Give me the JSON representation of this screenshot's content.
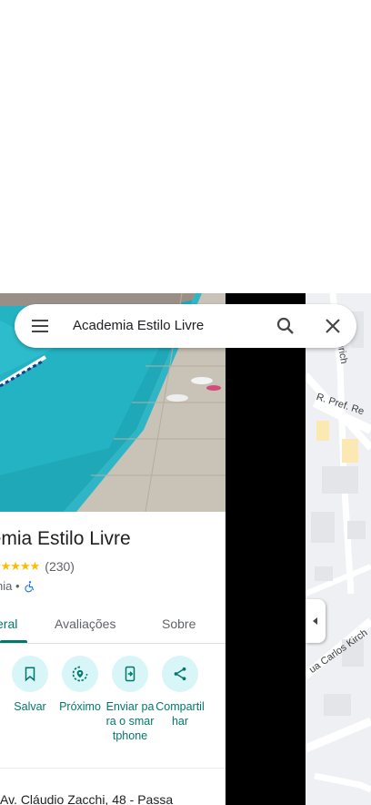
{
  "search": {
    "query": "Academia Estilo Livre"
  },
  "place": {
    "title": "demia Estilo Livre",
    "stars": "★★★★★",
    "review_count": "(230)",
    "category": "nia •"
  },
  "tabs": [
    {
      "label": "eral",
      "active": true
    },
    {
      "label": "Avaliações",
      "active": false
    },
    {
      "label": "Sobre",
      "active": false
    }
  ],
  "actions": [
    {
      "label": "Salvar",
      "icon": "bookmark-icon"
    },
    {
      "label": "Próximo",
      "icon": "nearby-icon"
    },
    {
      "label": "Enviar para o smartphone",
      "icon": "send-to-phone-icon"
    },
    {
      "label": "Compartilhar",
      "icon": "share-icon"
    }
  ],
  "address": "Av. Cláudio Zacchi, 48 - Passa",
  "map": {
    "labels": [
      "o Henrich",
      "R. Pref. Re",
      "ua Carlos Kirch"
    ]
  },
  "colors": {
    "accent": "#00796b",
    "action_bg": "#d8f5f8",
    "star": "#fbbc04"
  }
}
